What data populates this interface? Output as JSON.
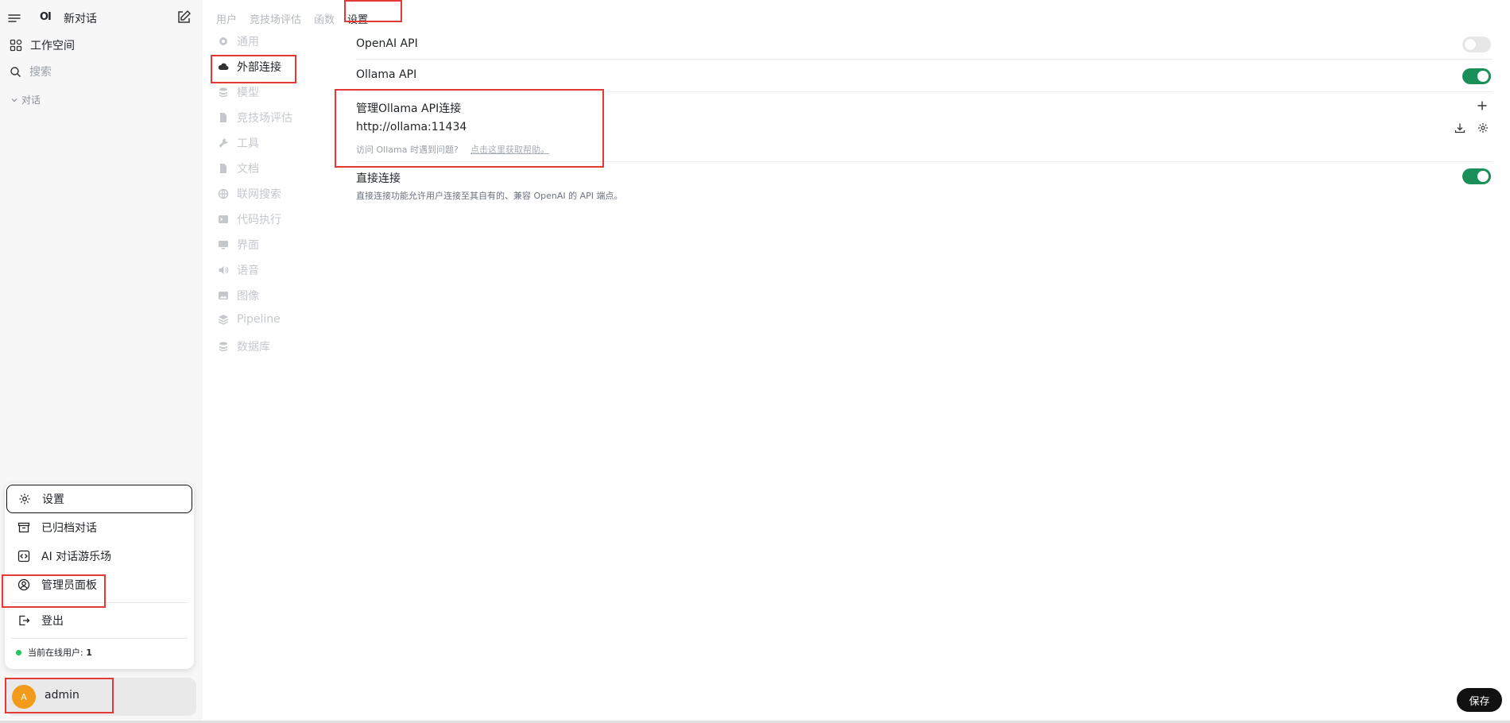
{
  "sidebar": {
    "new_chat_label": "新对话",
    "logo_text": "OI",
    "workspace_label": "工作空间",
    "search_placeholder": "搜索",
    "conversations_label": "对话"
  },
  "popup_menu": {
    "items": [
      {
        "label": "设置",
        "icon": "gear-icon"
      },
      {
        "label": "已归档对话",
        "icon": "archive-icon"
      },
      {
        "label": "AI 对话游乐场",
        "icon": "code-icon"
      },
      {
        "label": "管理员面板",
        "icon": "user-circle-icon"
      },
      {
        "label": "登出",
        "icon": "logout-icon"
      }
    ],
    "online_label": "当前在线用户: ",
    "online_count": "1"
  },
  "user": {
    "avatar_letter": "A",
    "name": "admin"
  },
  "top_tabs": [
    {
      "label": "用户",
      "active": false
    },
    {
      "label": "竞技场评估",
      "active": false
    },
    {
      "label": "函数",
      "active": false
    },
    {
      "label": "设置",
      "active": true
    }
  ],
  "settings_nav": [
    {
      "label": "通用",
      "icon": "gear-icon",
      "active": false
    },
    {
      "label": "外部连接",
      "icon": "cloud-icon",
      "active": true
    },
    {
      "label": "模型",
      "icon": "stack-icon",
      "active": false
    },
    {
      "label": "竞技场评估",
      "icon": "document-icon",
      "active": false
    },
    {
      "label": "工具",
      "icon": "wrench-icon",
      "active": false
    },
    {
      "label": "文档",
      "icon": "document-icon",
      "active": false
    },
    {
      "label": "联网搜索",
      "icon": "globe-icon",
      "active": false
    },
    {
      "label": "代码执行",
      "icon": "terminal-icon",
      "active": false
    },
    {
      "label": "界面",
      "icon": "monitor-icon",
      "active": false
    },
    {
      "label": "语音",
      "icon": "speaker-icon",
      "active": false
    },
    {
      "label": "图像",
      "icon": "image-icon",
      "active": false
    },
    {
      "label": "Pipeline",
      "icon": "layers-icon",
      "active": false
    },
    {
      "label": "数据库",
      "icon": "database-icon",
      "active": false
    }
  ],
  "connections": {
    "openai_label": "OpenAI API",
    "openai_enabled": false,
    "ollama_label": "Ollama API",
    "ollama_enabled": true,
    "manage_ollama_label": "管理Ollama API连接",
    "ollama_url": "http://ollama:11434",
    "trouble_text": "访问 Ollama 时遇到问题?",
    "help_link": "点击这里获取帮助。",
    "direct_label": "直接连接",
    "direct_enabled": true,
    "direct_desc": "直接连接功能允许用户连接至其自有的、兼容 OpenAI 的 API 端点。"
  },
  "save_label": "保存",
  "colors": {
    "toggle_on": "#1a8f5a",
    "highlight": "#e53935",
    "online_dot": "#22c55e",
    "avatar": "#f29a1a"
  }
}
